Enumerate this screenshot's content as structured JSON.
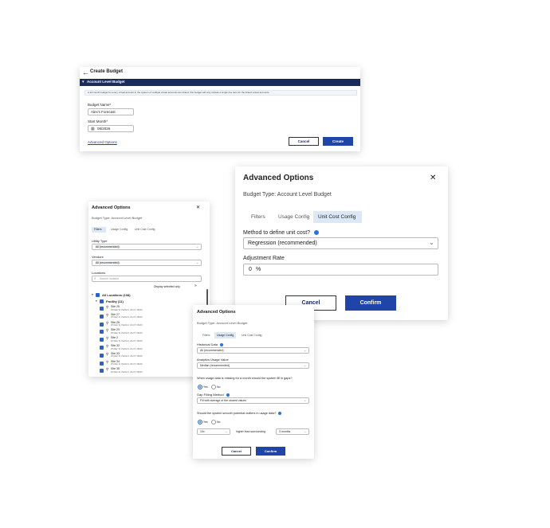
{
  "create_budget": {
    "back_arrow": "←",
    "title": "Create Budget",
    "section_header": "Account Level Budget",
    "info_text": "A 12-month budget for every virtual account in the system of multiple virtual accounts are linked, this budget will only include a single line item for the linked virtual accounts.",
    "budget_name_label": "Budget Name*",
    "budget_name_value": "Alex's Forecast",
    "start_month_label": "Start Month*",
    "start_month_value": "08/2026",
    "advanced_link": "Advanced Options",
    "cancel_label": "Cancel",
    "create_label": "Create"
  },
  "adv_large": {
    "title": "Advanced Options",
    "close": "✕",
    "budget_type": "Budget Type: Account Level Budget",
    "tabs": [
      "Filters",
      "Usage Config",
      "Unit Cost Config"
    ],
    "method_label": "Method to define unit cost?",
    "method_value": "Regression (recommended)",
    "rate_label": "Adjustment Rate",
    "rate_value": "0",
    "rate_unit": "%",
    "cancel_label": "Cancel",
    "confirm_label": "Confirm"
  },
  "adv_filters": {
    "title": "Advanced Options",
    "close": "✕",
    "budget_type": "Budget Type: Account Level Budget",
    "tabs": [
      "Filters",
      "Usage Config",
      "Unit Cost Config"
    ],
    "utility_label": "Utility Type",
    "utility_chip": "All (recommended)",
    "vendors_label": "Vendors",
    "vendors_chip": "All (recommended)",
    "locations_label": "Locations",
    "search_placeholder": "Search location",
    "display_selected": "Display selected only",
    "all_locations": "All Locations (108)",
    "facility": "Facility (11)",
    "site_sub": "25 Main St, Hartford, US-CT, 06106",
    "sites": [
      "Site 25",
      "Site 27",
      "Site 28",
      "Site 29",
      "Site 2",
      "Site 32",
      "Site 33",
      "Site 34",
      "Site 35"
    ]
  },
  "adv_usage": {
    "title": "Advanced Options",
    "budget_type": "Budget Type: Account Level Budget",
    "tabs": [
      "Filters",
      "Usage Config",
      "Unit Cost Config"
    ],
    "historical_label": "Historical Data",
    "historical_value": "All (recommended)",
    "analytics_label": "Analytics Usage Value",
    "analytics_value": "Median (recommended)",
    "missing_question": "When usage data is missing for a month should the system fill in gaps?",
    "yes": "Yes",
    "no": "No",
    "gap_label": "Gap Filling Method",
    "gap_value": "Fill with average of the closest values",
    "outlier_question": "Should the system smooth potential outliers in usage data?",
    "factor_value": "10x",
    "higher_than": "higher than surrounding",
    "months_value": "3 months",
    "cancel_label": "Cancel",
    "confirm_label": "Confirm"
  },
  "colors": {
    "primary": "#1f45a8",
    "header_bar": "#1a2a5a",
    "tab_selected": "#dde8f7",
    "checkbox": "#2a63c8"
  }
}
